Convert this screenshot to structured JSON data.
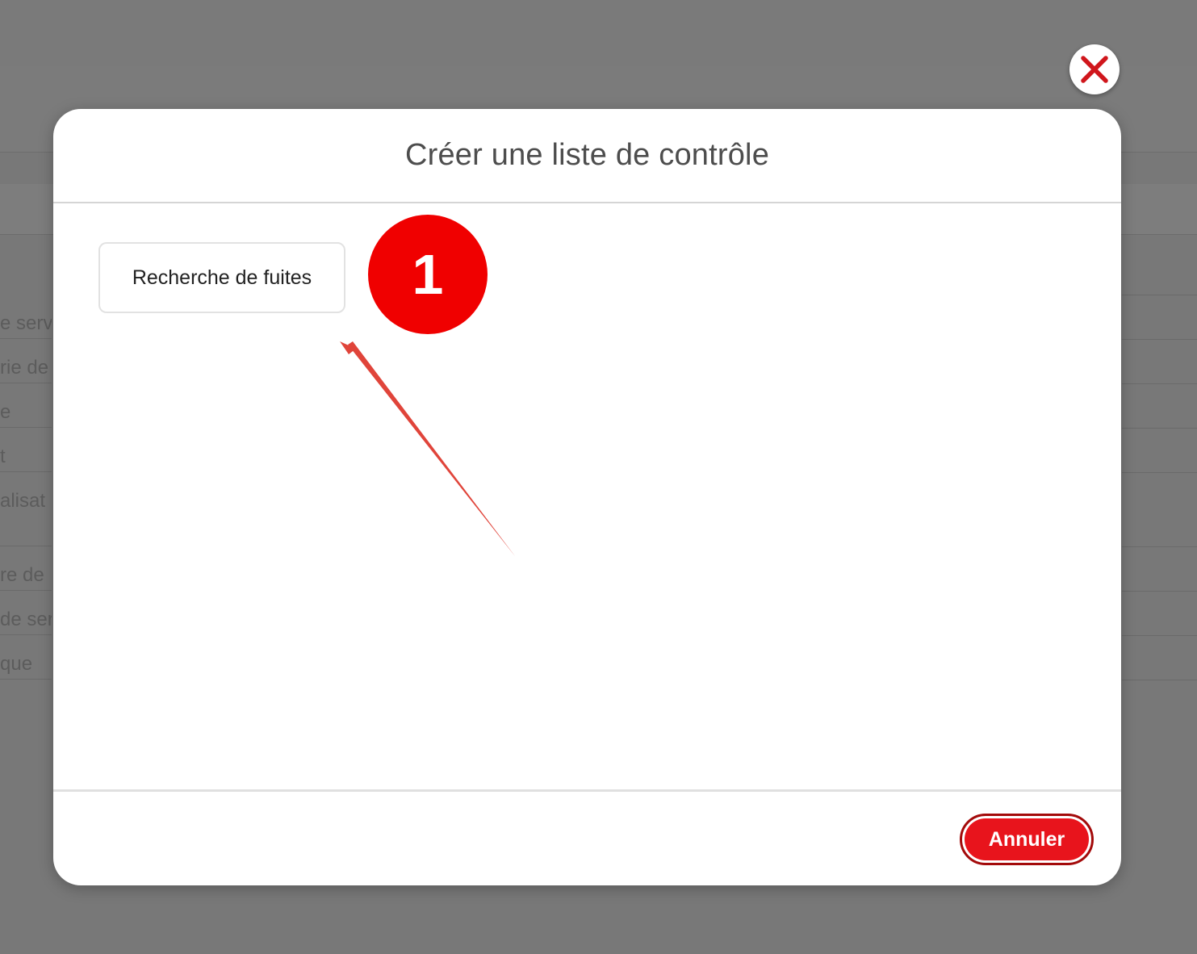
{
  "modal": {
    "title": "Créer une liste de contrôle",
    "options": [
      {
        "label": "Recherche de fuites"
      }
    ],
    "cancel_label": "Annuler"
  },
  "annotation": {
    "step_number": "1",
    "color": "#f00000",
    "arrow_color": "#e0443a"
  },
  "background": {
    "rows": [
      "e serv",
      "rie de",
      "e",
      "t",
      "alisat",
      "re de",
      "de ser",
      "que"
    ]
  },
  "icons": {
    "close": "close-x-icon"
  },
  "colors": {
    "overlay": "#787878",
    "accent_red": "#e8141c",
    "close_x": "#d0161c"
  }
}
